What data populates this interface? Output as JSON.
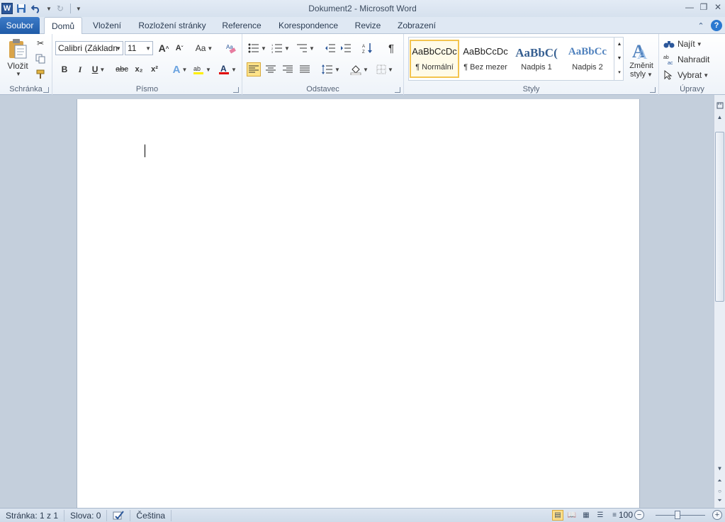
{
  "window": {
    "title": "Dokument2 - Microsoft Word",
    "app_letter": "W"
  },
  "tabs": {
    "file": "Soubor",
    "items": [
      "Domů",
      "Vložení",
      "Rozložení stránky",
      "Reference",
      "Korespondence",
      "Revize",
      "Zobrazení"
    ]
  },
  "ribbon": {
    "clipboard": {
      "label": "Schránka",
      "paste": "Vložit"
    },
    "font": {
      "label": "Písmo",
      "font_name": "Calibri (Základn",
      "font_size": "11",
      "bold": "B",
      "italic": "I",
      "underline": "U",
      "strike": "abc",
      "sub": "x₂",
      "sup": "x²",
      "grow": "A",
      "shrink": "A",
      "case": "Aa"
    },
    "paragraph": {
      "label": "Odstavec",
      "pilcrow": "¶"
    },
    "styles": {
      "label": "Styly",
      "items": [
        {
          "preview": "AaBbCcDc",
          "name": "¶ Normální"
        },
        {
          "preview": "AaBbCcDc",
          "name": "¶ Bez mezer"
        },
        {
          "preview": "AaBbC(",
          "name": "Nadpis 1"
        },
        {
          "preview": "AaBbCc",
          "name": "Nadpis 2"
        }
      ],
      "change_line1": "Změnit",
      "change_line2": "styly"
    },
    "editing": {
      "label": "Úpravy",
      "find": "Najít",
      "replace": "Nahradit",
      "select": "Vybrat"
    }
  },
  "status": {
    "page": "Stránka: 1 z 1",
    "words": "Slova: 0",
    "language": "Čeština",
    "zoom": "100 %"
  }
}
